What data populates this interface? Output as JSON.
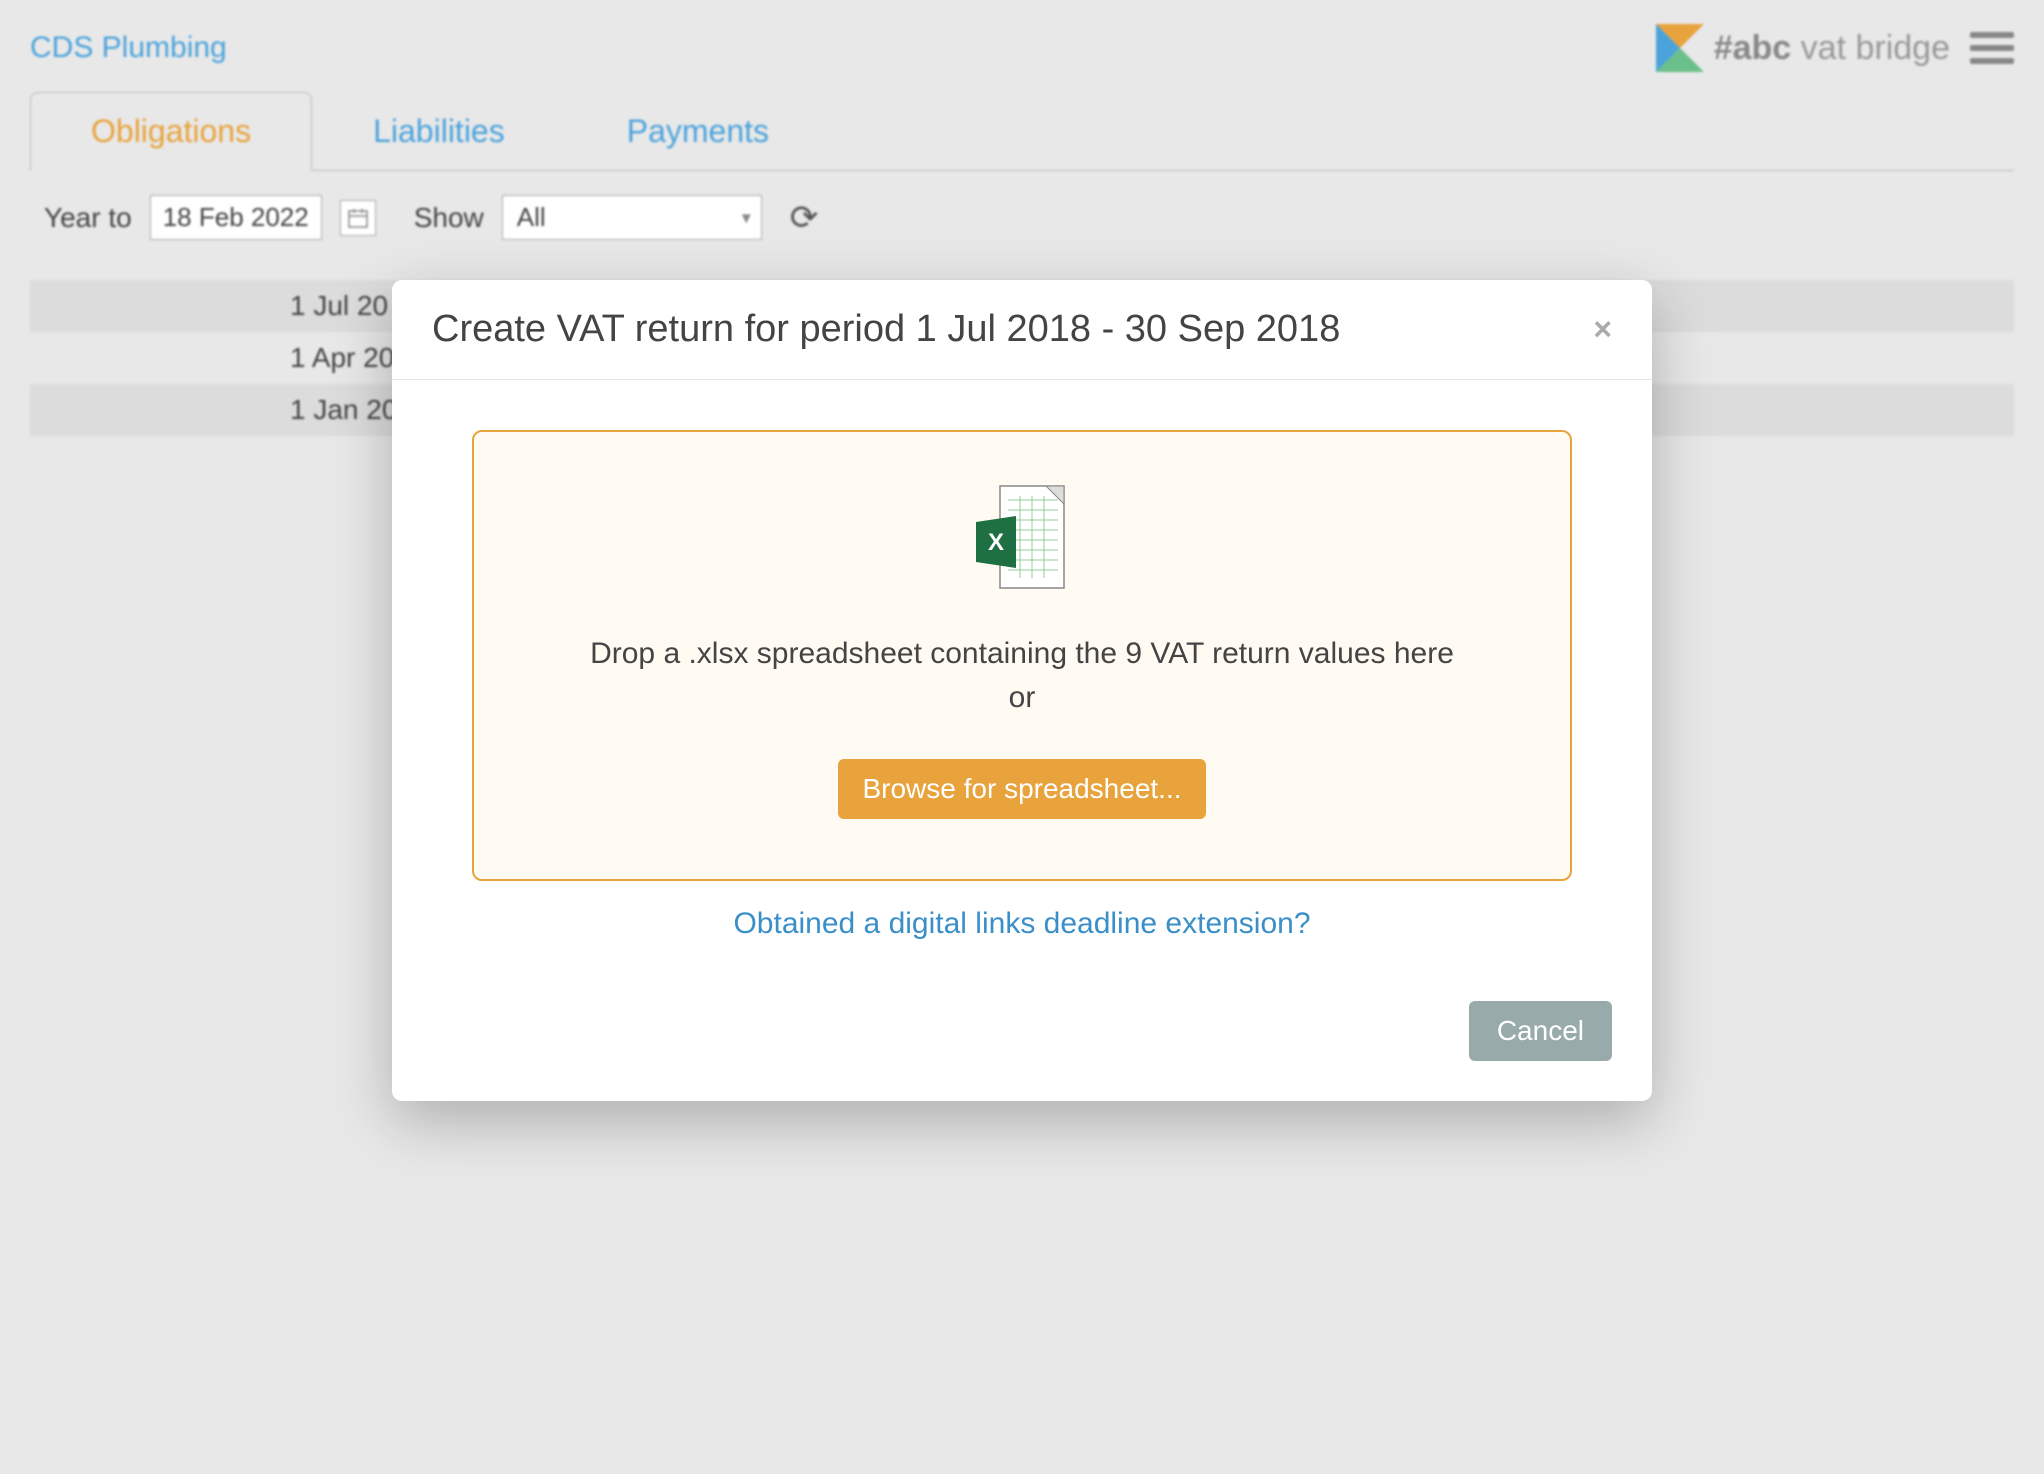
{
  "header": {
    "company": "CDS Plumbing",
    "brand_prefix": "#abc",
    "brand_suffix": "vat bridge"
  },
  "tabs": {
    "obligations": "Obligations",
    "liabilities": "Liabilities",
    "payments": "Payments"
  },
  "filter": {
    "year_to_label": "Year to",
    "year_to_value": "18 Feb 2022",
    "show_label": "Show",
    "show_value": "All"
  },
  "rows": {
    "r0": "1 Jul 20",
    "r1": "1 Apr 20",
    "r2": "1 Jan 20"
  },
  "modal": {
    "title": "Create VAT return for period 1 Jul 2018 - 30 Sep 2018",
    "close": "×",
    "drop_line1": "Drop a .xlsx spreadsheet containing the 9 VAT return values here",
    "drop_line2": "or",
    "browse_label": "Browse for spreadsheet...",
    "extension_link": "Obtained a digital links deadline extension?",
    "cancel_label": "Cancel"
  }
}
